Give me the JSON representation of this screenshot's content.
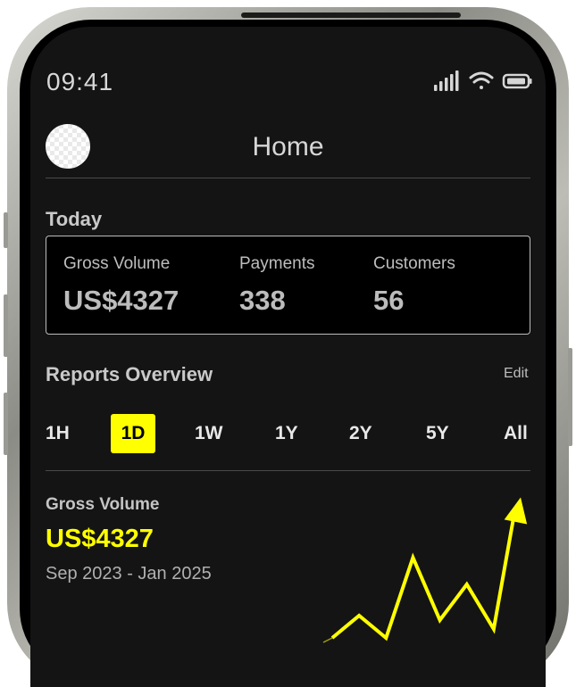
{
  "status_bar": {
    "time": "09:41",
    "icons": [
      "cellular-signal-icon",
      "wifi-icon",
      "battery-icon"
    ]
  },
  "header": {
    "title": "Home"
  },
  "today": {
    "title": "Today",
    "metrics": [
      {
        "label": "Gross Volume",
        "value": "US$4327"
      },
      {
        "label": "Payments",
        "value": "338"
      },
      {
        "label": "Customers",
        "value": "56"
      }
    ]
  },
  "reports": {
    "title": "Reports Overview",
    "edit_label": "Edit",
    "ranges": [
      "1H",
      "1D",
      "1W",
      "1Y",
      "2Y",
      "5Y",
      "All"
    ],
    "selected_range": "1D"
  },
  "gross_volume": {
    "label": "Gross Volume",
    "value": "US$4327",
    "date_range": "Sep 2023 - Jan 2025"
  },
  "colors": {
    "accent": "#ffff00",
    "background": "#141414",
    "text": "#c9c9c9"
  },
  "chart_data": {
    "type": "line",
    "x": [
      0,
      1,
      2,
      3,
      4,
      5,
      6,
      7
    ],
    "values": [
      1,
      2,
      1,
      4.6,
      1.8,
      3.4,
      1.4,
      7.3
    ],
    "end_marker": "arrow"
  }
}
